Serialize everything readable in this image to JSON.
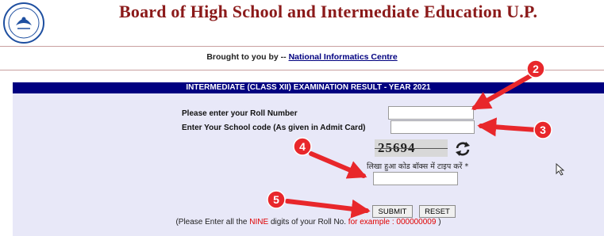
{
  "header": {
    "title": "Board of High School and Intermediate Education U.P."
  },
  "credit": {
    "prefix": "Brought to you by --",
    "link_text": "National Informatics Centre"
  },
  "panel": {
    "heading": "INTERMEDIATE (CLASS XII)  EXAMINATION RESULT - YEAR 2021",
    "roll_label": "Please enter your Roll Number",
    "roll_value": "",
    "school_label": "Enter Your School code (As given in Admit Card)",
    "school_value": "",
    "captcha_text": "25694",
    "captcha_prompt": "लिखा हुआ कोड बॉक्स में टाइप करें *",
    "captcha_value": "",
    "submit_label": "SUBMIT",
    "reset_label": "RESET",
    "note": {
      "part1": "(Please Enter all the",
      "nine": "NINE",
      "part2": "digits of your Roll No.",
      "example": "for example : 000000009",
      "close": ")"
    }
  },
  "annotations": {
    "color": "#e8272b",
    "markers": [
      "2",
      "3",
      "4",
      "5"
    ]
  }
}
